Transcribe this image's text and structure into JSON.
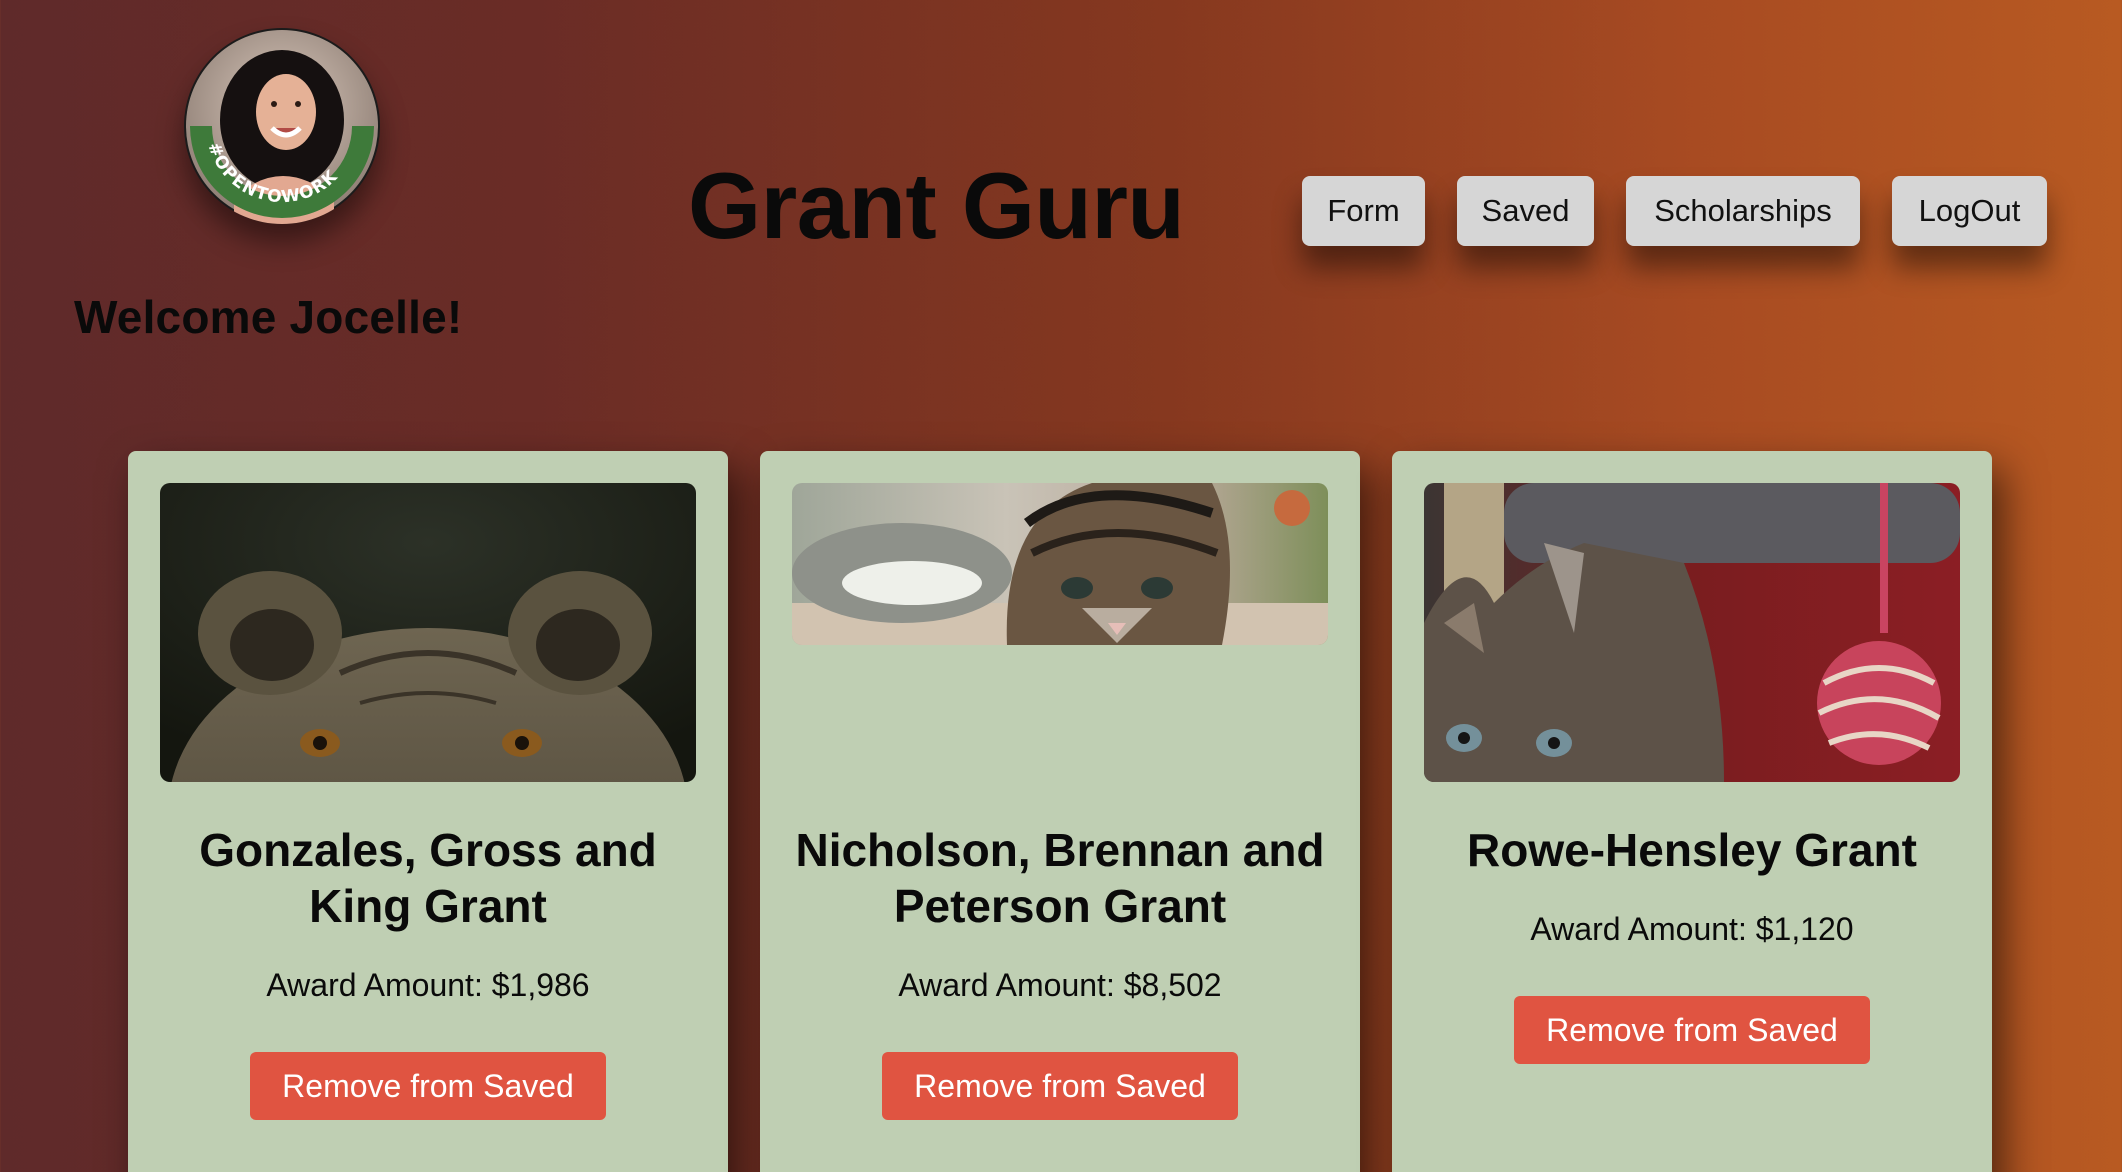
{
  "header": {
    "title": "Grant Guru",
    "welcome": "Welcome Jocelle!",
    "avatar_badge": "#OPENTOWORK"
  },
  "nav": {
    "items": [
      {
        "label": "Form"
      },
      {
        "label": "Saved"
      },
      {
        "label": "Scholarships"
      },
      {
        "label": "LogOut"
      }
    ]
  },
  "cards": [
    {
      "title": "Gonzales, Gross and King Grant",
      "amount": "Award Amount: $1,986",
      "button": "Remove from Saved",
      "image": "lion-photo"
    },
    {
      "title": "Nicholson, Brennan and Peterson Grant",
      "amount": "Award Amount: $8,502",
      "button": "Remove from Saved",
      "image": "kitten-photo"
    },
    {
      "title": "Rowe-Hensley Grant",
      "amount": "Award Amount: $1,120",
      "button": "Remove from Saved",
      "image": "kitten-with-yarn-ball-photo"
    }
  ],
  "colors": {
    "background_start": "#5f2a2a",
    "background_end": "#b85a22",
    "card": "#bfcfb3",
    "remove_button": "#e05441",
    "nav_button": "#d6d6d6",
    "avatar_badge": "#3e7a3a"
  }
}
